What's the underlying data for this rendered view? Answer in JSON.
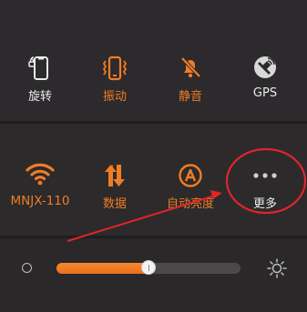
{
  "quick_settings": {
    "row1": [
      {
        "id": "rotate",
        "label": "旋转",
        "icon": "phone-rotate-icon",
        "active": false
      },
      {
        "id": "vibrate",
        "label": "振动",
        "icon": "vibrate-icon",
        "active": true
      },
      {
        "id": "mute",
        "label": "静音",
        "icon": "bell-muted-icon",
        "active": true
      },
      {
        "id": "gps",
        "label": "GPS",
        "icon": "gps-satellite-icon",
        "active": false
      }
    ],
    "row2": [
      {
        "id": "wifi",
        "label": "MNJX-110",
        "icon": "wifi-icon",
        "active": true
      },
      {
        "id": "data",
        "label": "数据",
        "icon": "data-arrows-icon",
        "active": true
      },
      {
        "id": "auto_brightness",
        "label": "自动亮度",
        "icon": "auto-brightness-icon",
        "active": true
      },
      {
        "id": "more",
        "label": "更多",
        "icon": "more-dots-icon",
        "active": false
      }
    ]
  },
  "brightness": {
    "level": 0.5,
    "min_icon": "brightness-low-icon",
    "max_icon": "brightness-high-icon"
  },
  "colors": {
    "accent": "#f07c26",
    "background": "#2c2a2b",
    "text": "#ececec",
    "annotation": "#e0242a"
  }
}
